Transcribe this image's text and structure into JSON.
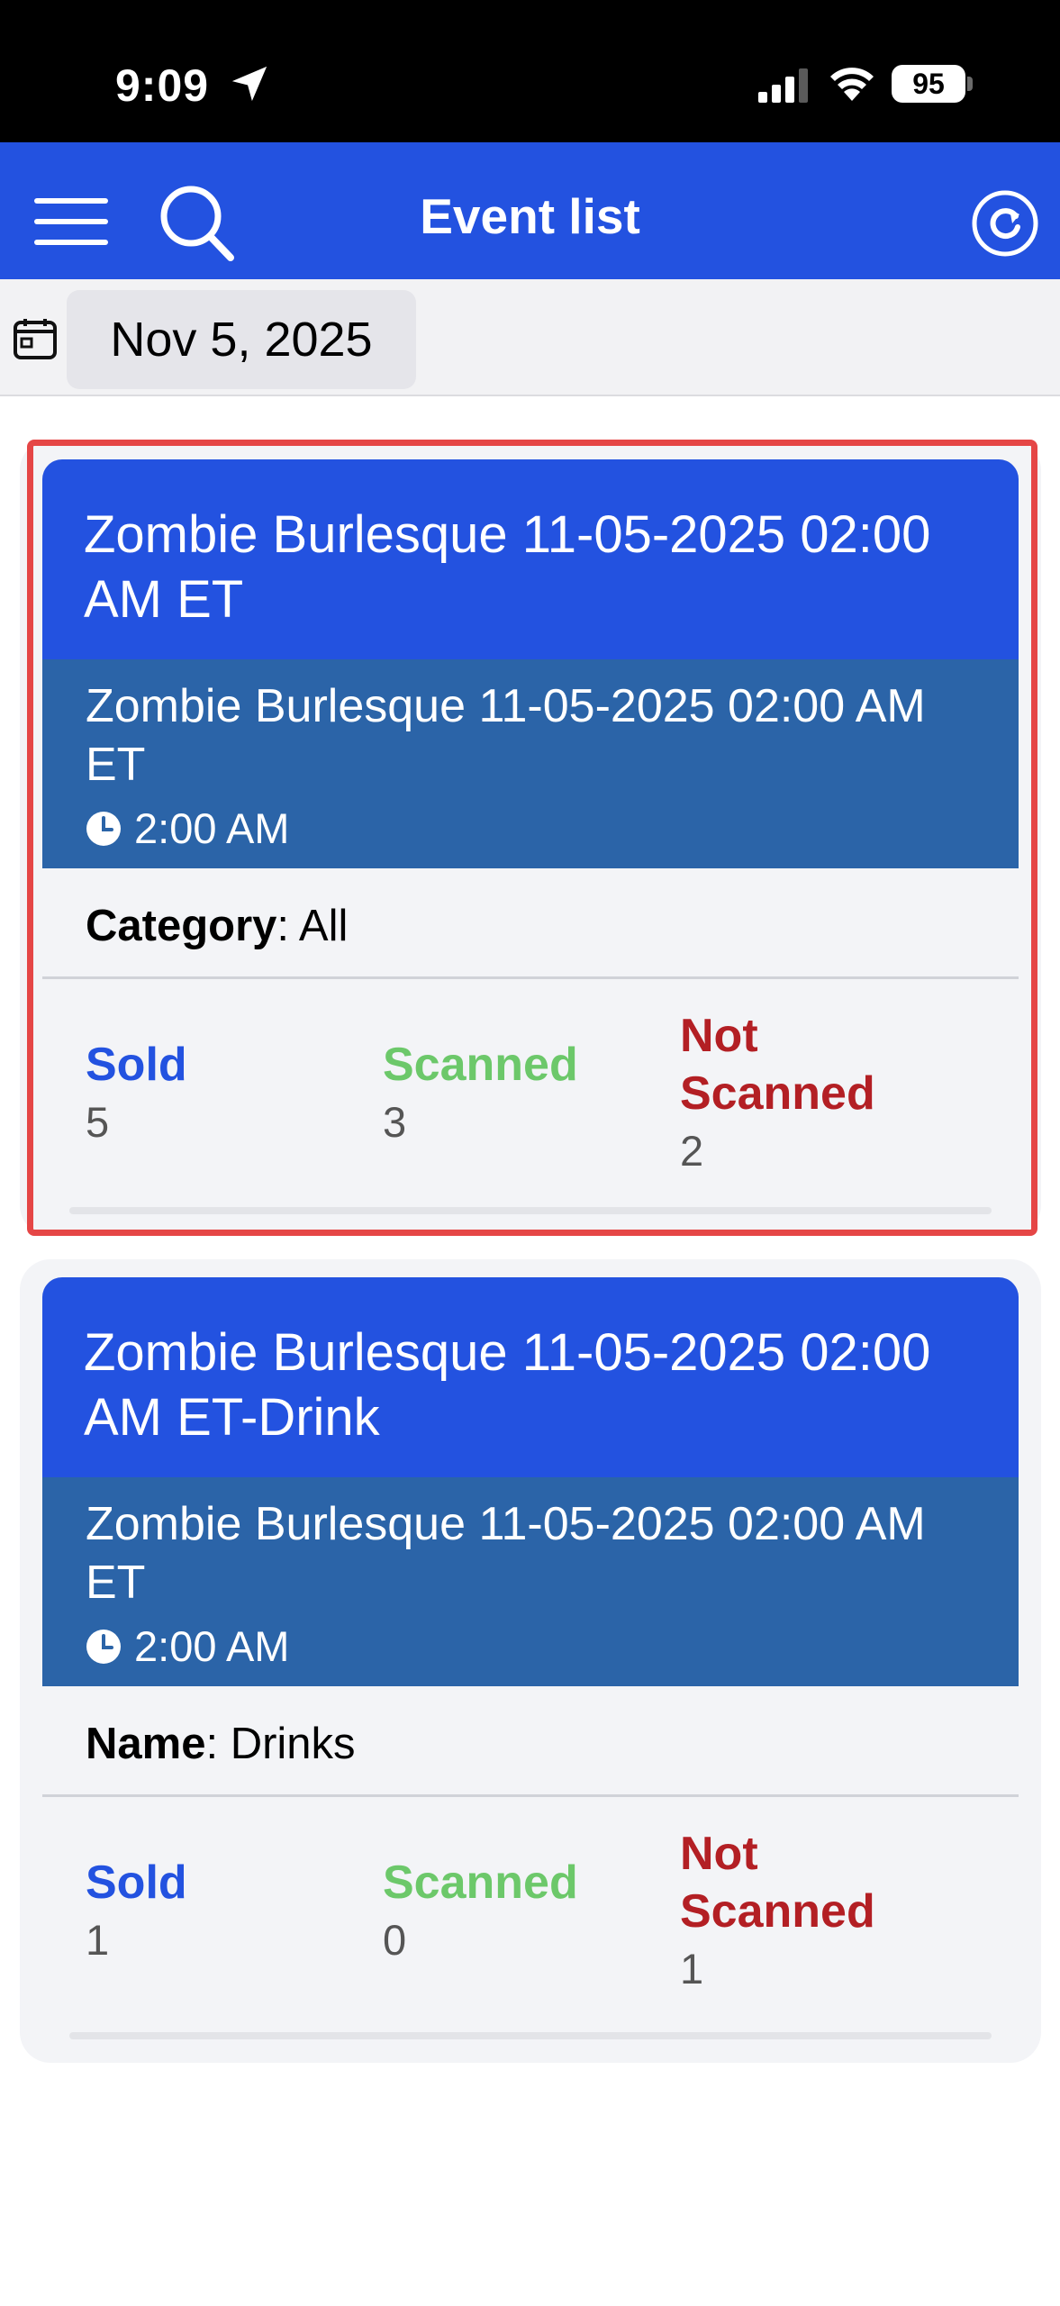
{
  "status_bar": {
    "time": "9:09",
    "battery": "95"
  },
  "header": {
    "title": "Event list"
  },
  "date_filter": {
    "date": "Nov 5, 2025"
  },
  "events": [
    {
      "title": "Zombie Burlesque 11-05-2025 02:00 AM ET",
      "subtitle": "Zombie Burlesque 11-05-2025 02:00 AM ET",
      "time": "2:00 AM",
      "detail_label": "Category",
      "detail_value": ": All",
      "sold_label": "Sold",
      "sold": "5",
      "scanned_label": "Scanned",
      "scanned": "3",
      "not_scanned_label": "Not Scanned",
      "not_scanned": "2"
    },
    {
      "title": "Zombie Burlesque 11-05-2025 02:00 AM ET-Drink",
      "subtitle": "Zombie Burlesque 11-05-2025 02:00 AM ET",
      "time": "2:00 AM",
      "detail_label": "Name",
      "detail_value": ": Drinks",
      "sold_label": "Sold",
      "sold": "1",
      "scanned_label": "Scanned",
      "scanned": "0",
      "not_scanned_label": "Not Scanned",
      "not_scanned": "1"
    }
  ],
  "colors": {
    "primary": "#2352e0",
    "secondary": "#2b64a8",
    "sold": "#2352e0",
    "scanned": "#6cc86a",
    "not_scanned": "#b31f24",
    "highlight": "#e54646"
  }
}
